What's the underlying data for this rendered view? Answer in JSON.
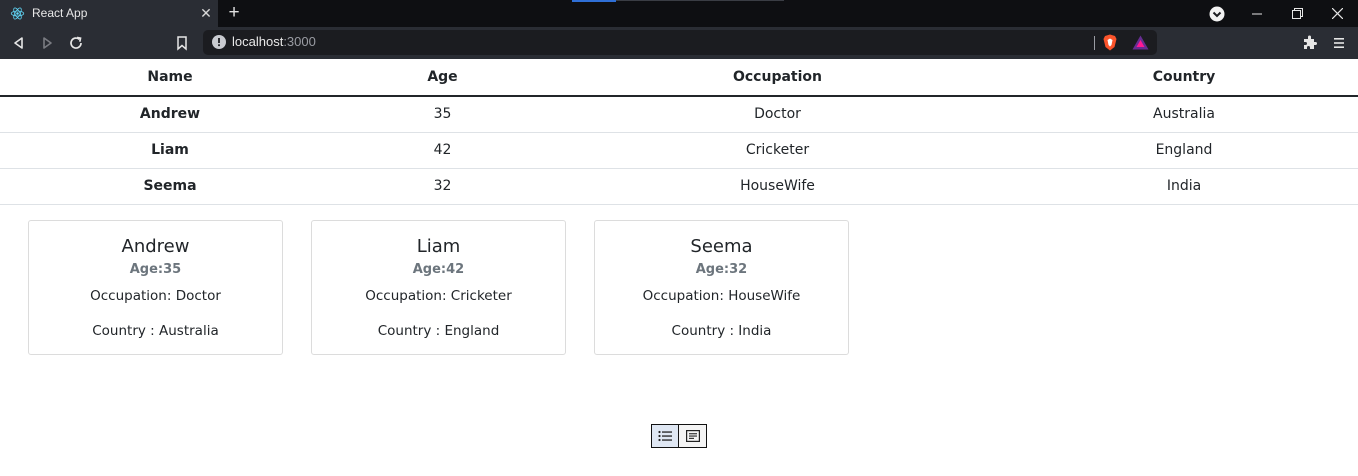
{
  "browser": {
    "tab_title": "React App",
    "url_host": "localhost",
    "url_port": ":3000"
  },
  "table": {
    "headers": [
      "Name",
      "Age",
      "Occupation",
      "Country"
    ],
    "rows": [
      {
        "name": "Andrew",
        "age": "35",
        "occupation": "Doctor",
        "country": "Australia"
      },
      {
        "name": "Liam",
        "age": "42",
        "occupation": "Cricketer",
        "country": "England"
      },
      {
        "name": "Seema",
        "age": "32",
        "occupation": "HouseWife",
        "country": "India"
      }
    ]
  },
  "cards": [
    {
      "name": "Andrew",
      "age": "Age:35",
      "occupation": "Occupation: Doctor",
      "country": "Country : Australia"
    },
    {
      "name": "Liam",
      "age": "Age:42",
      "occupation": "Occupation: Cricketer",
      "country": "Country : England"
    },
    {
      "name": "Seema",
      "age": "Age:32",
      "occupation": "Occupation: HouseWife",
      "country": "Country : India"
    }
  ],
  "view_toggle": {
    "options": [
      "list-view-icon",
      "card-view-icon"
    ],
    "selected": "list-view-icon"
  },
  "colors": {
    "chrome_bg": "#2a2d34",
    "tabbar_bg": "#0e0f12",
    "text": "#212529",
    "muted": "#6c757d"
  }
}
